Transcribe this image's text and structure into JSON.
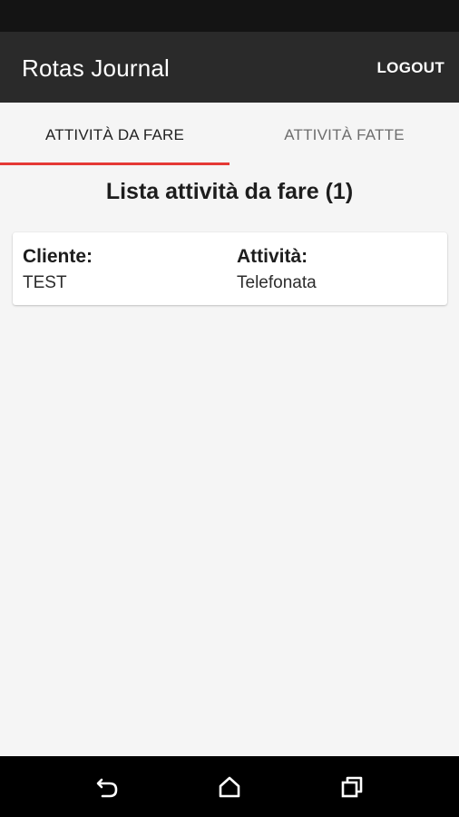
{
  "app_bar": {
    "title": "Rotas Journal",
    "logout_label": "LOGOUT"
  },
  "tabs": [
    {
      "label": "ATTIVITÀ DA FARE",
      "active": true
    },
    {
      "label": "ATTIVITÀ FATTE",
      "active": false
    }
  ],
  "content": {
    "title": "Lista attività da fare (1)",
    "items": [
      {
        "cliente_label": "Cliente:",
        "cliente_value": "TEST",
        "attivita_label": "Attività:",
        "attivita_value": "Telefonata"
      }
    ]
  },
  "nav_bar": {
    "back_icon": "back-icon",
    "home_icon": "home-icon",
    "recent_icon": "recent-apps-icon"
  },
  "colors": {
    "status_bar": "#141414",
    "app_bar": "#2a2a2a",
    "accent": "#e53935",
    "background": "#f5f5f5"
  }
}
